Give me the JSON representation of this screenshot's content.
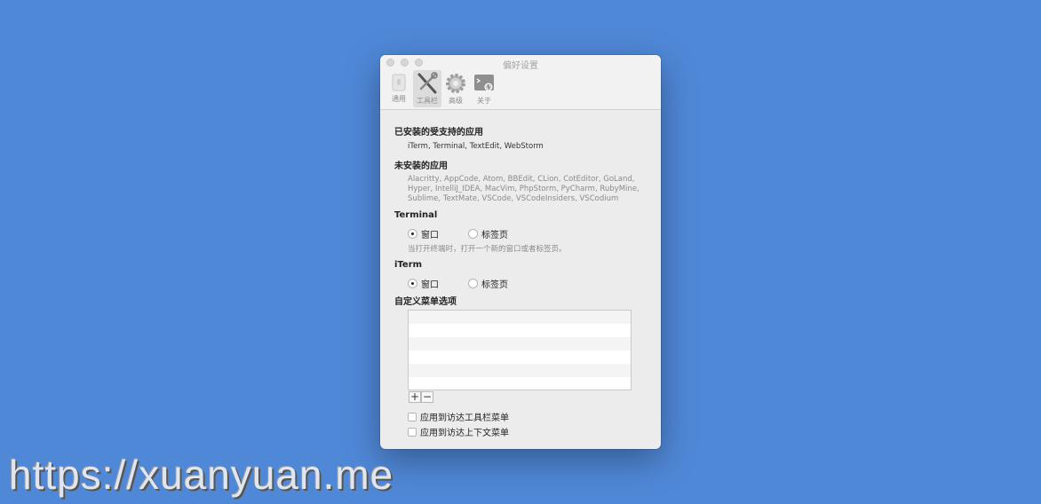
{
  "window": {
    "title": "偏好设置"
  },
  "toolbar": {
    "items": [
      {
        "label": "通用",
        "icon": "switch-icon"
      },
      {
        "label": "工具栏",
        "icon": "tools-icon"
      },
      {
        "label": "高级",
        "icon": "gear-icon"
      },
      {
        "label": "关于",
        "icon": "terminal-icon"
      }
    ],
    "selected": "工具栏"
  },
  "installed": {
    "heading": "已安装的受支持的应用",
    "apps": "iTerm, Terminal, TextEdit, WebStorm"
  },
  "not_installed": {
    "heading": "未安装的应用",
    "apps": "Alacritty, AppCode, Atom, BBEdit, CLion, CotEditor, GoLand, Hyper, IntelliJ_IDEA, MacVim, PhpStorm, PyCharm, RubyMine, Sublime, TextMate, VSCode, VSCodeInsiders, VSCodium"
  },
  "terminal": {
    "heading": "Terminal",
    "option_window": "窗口",
    "option_tab": "标签页",
    "selected": "窗口",
    "hint": "当打开终端时，打开一个新的窗口或者标签页。"
  },
  "iterm": {
    "heading": "iTerm",
    "option_window": "窗口",
    "option_tab": "标签页",
    "selected": "窗口"
  },
  "custom_menu": {
    "heading": "自定义菜单选项",
    "add_label": "+",
    "remove_label": "−"
  },
  "checkboxes": {
    "finder_toolbar": "应用到访达工具栏菜单",
    "finder_context": "应用到访达上下文菜单"
  },
  "watermark": "https://xuanyuan.me",
  "colors": {
    "desktop": "#5088d8",
    "window": "#ececec"
  }
}
